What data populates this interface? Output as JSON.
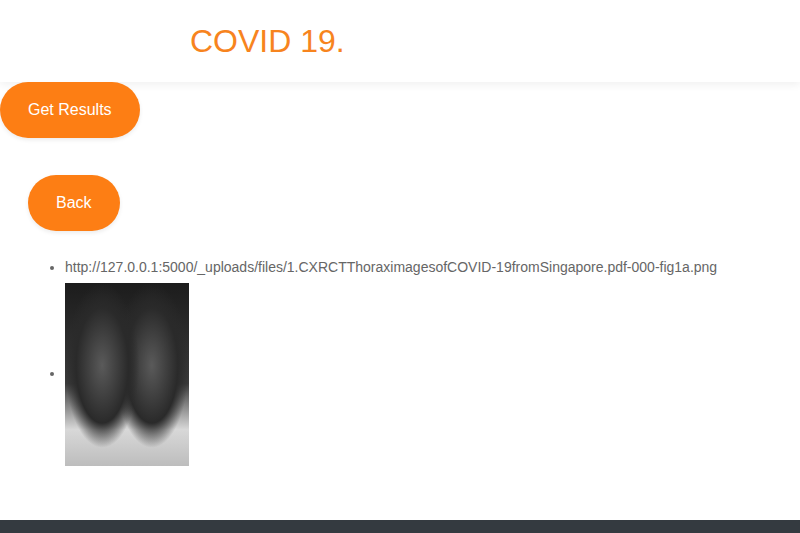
{
  "header": {
    "title": "COVID 19."
  },
  "buttons": [
    {
      "label": "Get Results"
    },
    {
      "label": "Back"
    }
  ],
  "files": [
    {
      "kind": "link",
      "text": "http://127.0.0.1:5000/_uploads/files/1.CXRCTThoraximagesofCOVID-19fromSingapore.pdf-000-fig1a.png"
    },
    {
      "kind": "image"
    }
  ]
}
